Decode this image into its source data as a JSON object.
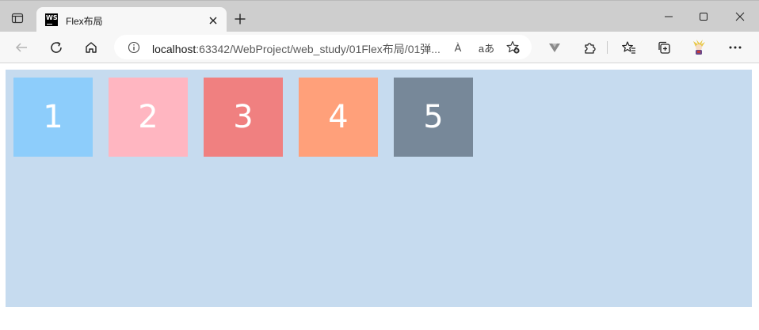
{
  "browser": {
    "tab": {
      "title": "Flex布局",
      "favicon_text": "WS"
    },
    "address": {
      "host": "localhost",
      "rest": ":63342/WebProject/web_study/01Flex布局/01弹..."
    },
    "icons": {
      "read_aloud": "À",
      "translate": "aあ"
    }
  },
  "page": {
    "items": [
      {
        "label": "1",
        "color": "#8dcdfb"
      },
      {
        "label": "2",
        "color": "#ffb6c1"
      },
      {
        "label": "3",
        "color": "#f08080"
      },
      {
        "label": "4",
        "color": "#ffa07a"
      },
      {
        "label": "5",
        "color": "#778899"
      }
    ],
    "container_color": "#c6dbef"
  }
}
